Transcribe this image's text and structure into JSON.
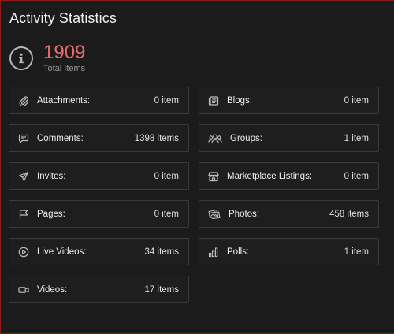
{
  "header": {
    "title": "Activity Statistics"
  },
  "total": {
    "value": "1909",
    "label": "Total Items",
    "icon": "info-icon"
  },
  "colors": {
    "accent": "#e86a6a",
    "background": "#1b1b1b",
    "border": "#3a3a3a"
  },
  "stats": [
    {
      "label": "Attachments:",
      "value": "0 item",
      "icon": "paperclip-icon"
    },
    {
      "label": "Blogs:",
      "value": "0 item",
      "icon": "blog-icon"
    },
    {
      "label": "Comments:",
      "value": "1398 items",
      "icon": "comment-icon"
    },
    {
      "label": "Groups:",
      "value": "1 item",
      "icon": "groups-icon"
    },
    {
      "label": "Invites:",
      "value": "0 item",
      "icon": "send-icon"
    },
    {
      "label": "Marketplace Listings:",
      "value": "0 item",
      "icon": "store-icon"
    },
    {
      "label": "Pages:",
      "value": "0 item",
      "icon": "flag-icon"
    },
    {
      "label": "Photos:",
      "value": "458 items",
      "icon": "photos-icon"
    },
    {
      "label": "Live Videos:",
      "value": "34 items",
      "icon": "play-circle-icon"
    },
    {
      "label": "Polls:",
      "value": "1 item",
      "icon": "poll-icon"
    },
    {
      "label": "Videos:",
      "value": "17 items",
      "icon": "video-camera-icon"
    }
  ]
}
